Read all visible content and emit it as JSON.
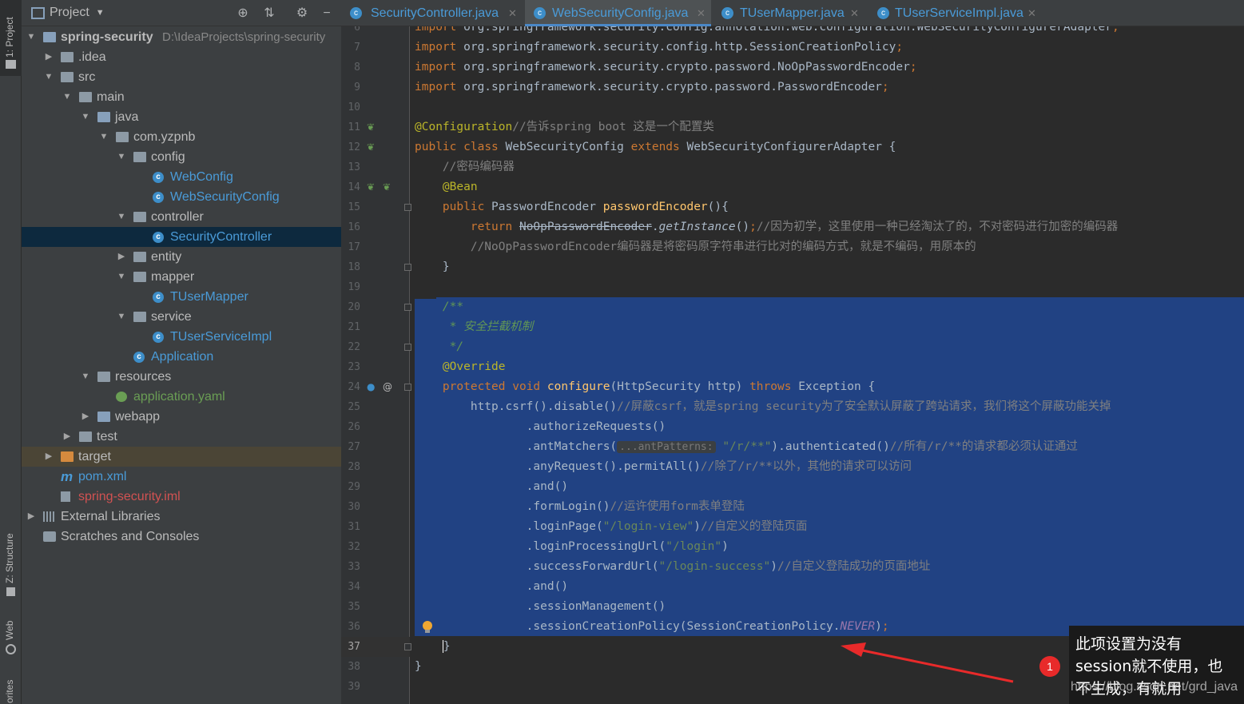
{
  "tool_strip": {
    "project_tab": "1: Project",
    "structure_tab": "Z: Structure",
    "web_tab": "Web",
    "favorites_tab": "orites"
  },
  "project_panel": {
    "title": "Project",
    "icons": [
      "globe-icon",
      "collapse-icon",
      "gear-icon",
      "minimize-icon"
    ],
    "tree": [
      {
        "label": "spring-security",
        "path": "D:\\IdeaProjects\\spring-security",
        "depth": 0,
        "expanded": true,
        "icon": "module-folder-icon"
      },
      {
        "label": ".idea",
        "depth": 1,
        "expanded": false,
        "icon": "folder-icon"
      },
      {
        "label": "src",
        "depth": 1,
        "expanded": true,
        "icon": "folder-icon"
      },
      {
        "label": "main",
        "depth": 2,
        "expanded": true,
        "icon": "folder-icon"
      },
      {
        "label": "java",
        "depth": 3,
        "expanded": true,
        "icon": "source-folder-icon"
      },
      {
        "label": "com.yzpnb",
        "depth": 4,
        "expanded": true,
        "icon": "package-icon"
      },
      {
        "label": "config",
        "depth": 5,
        "expanded": true,
        "icon": "package-icon"
      },
      {
        "label": "WebConfig",
        "depth": 6,
        "icon": "class-icon"
      },
      {
        "label": "WebSecurityConfig",
        "depth": 6,
        "icon": "class-icon"
      },
      {
        "label": "controller",
        "depth": 5,
        "expanded": true,
        "icon": "package-icon"
      },
      {
        "label": "SecurityController",
        "depth": 6,
        "icon": "class-icon",
        "selected": true
      },
      {
        "label": "entity",
        "depth": 5,
        "expanded": false,
        "icon": "package-icon"
      },
      {
        "label": "mapper",
        "depth": 5,
        "expanded": true,
        "icon": "package-icon"
      },
      {
        "label": "TUserMapper",
        "depth": 6,
        "icon": "class-icon"
      },
      {
        "label": "service",
        "depth": 5,
        "expanded": true,
        "icon": "package-icon"
      },
      {
        "label": "TUserServiceImpl",
        "depth": 6,
        "icon": "class-icon"
      },
      {
        "label": "Application",
        "depth": 5,
        "icon": "spring-boot-class-icon"
      },
      {
        "label": "resources",
        "depth": 3,
        "expanded": true,
        "icon": "resources-folder-icon"
      },
      {
        "label": "application.yaml",
        "depth": 4,
        "icon": "yaml-icon"
      },
      {
        "label": "webapp",
        "depth": 3,
        "expanded": false,
        "icon": "web-folder-icon"
      },
      {
        "label": "test",
        "depth": 2,
        "expanded": false,
        "icon": "folder-icon"
      },
      {
        "label": "target",
        "depth": 1,
        "expanded": false,
        "icon": "excluded-folder-icon",
        "highlighted": true
      },
      {
        "label": "pom.xml",
        "depth": 1,
        "icon": "maven-icon"
      },
      {
        "label": "spring-security.iml",
        "depth": 1,
        "icon": "iml-icon"
      },
      {
        "label": "External Libraries",
        "depth": 0,
        "expanded": false,
        "icon": "library-icon"
      },
      {
        "label": "Scratches and Consoles",
        "depth": 0,
        "icon": "scratches-icon"
      }
    ]
  },
  "tabs": [
    {
      "label": "SecurityController.java",
      "active": false
    },
    {
      "label": "WebSecurityConfig.java",
      "active": true
    },
    {
      "label": "TUserMapper.java",
      "active": false
    },
    {
      "label": "TUserServiceImpl.java",
      "active": false
    }
  ],
  "editor": {
    "current_line": 37,
    "lines": [
      {
        "n": 6,
        "text": "import org.springframework.security.config.annotation.web.configuration.WebSecurityConfigurerAdapter;"
      },
      {
        "n": 7,
        "text": "import org.springframework.security.config.http.SessionCreationPolicy;"
      },
      {
        "n": 8,
        "text": "import org.springframework.security.crypto.password.NoOpPasswordEncoder;"
      },
      {
        "n": 9,
        "text": "import org.springframework.security.crypto.password.PasswordEncoder;"
      },
      {
        "n": 10,
        "text": ""
      },
      {
        "n": 11,
        "annotation": "@Configuration",
        "comment": "//告诉spring boot 这是一个配置类"
      },
      {
        "n": 12,
        "text": "public class WebSecurityConfig extends WebSecurityConfigurerAdapter {"
      },
      {
        "n": 13,
        "comment": "    //密码编码器"
      },
      {
        "n": 14,
        "annotation": "    @Bean"
      },
      {
        "n": 15,
        "text": "    public PasswordEncoder passwordEncoder(){"
      },
      {
        "n": 16,
        "code": "        return NoOpPasswordEncoder.getInstance();",
        "comment": "//因为初学，这里使用一种已经淘汰了的，不对密码进行加密的编码器"
      },
      {
        "n": 17,
        "comment": "        //NoOpPasswordEncoder编码器是将密码原字符串进行比对的编码方式，就是不编码，用原本的"
      },
      {
        "n": 18,
        "text": "    }"
      },
      {
        "n": 19,
        "text": ""
      },
      {
        "n": 20,
        "doc": "    /**"
      },
      {
        "n": 21,
        "doc": "     * 安全拦截机制"
      },
      {
        "n": 22,
        "doc": "     */"
      },
      {
        "n": 23,
        "annotation": "    @Override"
      },
      {
        "n": 24,
        "text": "    protected void configure(HttpSecurity http) throws Exception {"
      },
      {
        "n": 25,
        "code": "        http.csrf().disable()",
        "comment": "//屏蔽csrf，就是spring security为了安全默认屏蔽了跨站请求，我们将这个屏蔽功能关掉"
      },
      {
        "n": 26,
        "code": "                .authorizeRequests()"
      },
      {
        "n": 27,
        "code": "                .antMatchers(",
        "hint": "...antPatterns:",
        "string": "\"/r/**\"",
        "code2": ").authenticated()",
        "comment": "//所有/r/**的请求都必须认证通过"
      },
      {
        "n": 28,
        "code": "                .anyRequest().permitAll()",
        "comment": "//除了/r/**以外，其他的请求可以访问"
      },
      {
        "n": 29,
        "code": "                .and()"
      },
      {
        "n": 30,
        "code": "                .formLogin()",
        "comment": "//运许使用form表单登陆"
      },
      {
        "n": 31,
        "code": "                .loginPage(",
        "string": "\"/login-view\"",
        "code2": ")",
        "comment": "//自定义的登陆页面"
      },
      {
        "n": 32,
        "code": "                .loginProcessingUrl(",
        "string": "\"/login\"",
        "code2": ")"
      },
      {
        "n": 33,
        "code": "                .successForwardUrl(",
        "string": "\"/login-success\"",
        "code2": ")",
        "comment": "//自定义登陆成功的页面地址"
      },
      {
        "n": 34,
        "code": "                .and()"
      },
      {
        "n": 35,
        "code": "                .sessionManagement()"
      },
      {
        "n": 36,
        "code": "                .sessionCreationPolicy(SessionCreationPolicy.",
        "const": "NEVER",
        "code2": ");"
      },
      {
        "n": 37,
        "text": "    }"
      },
      {
        "n": 38,
        "text": "}"
      },
      {
        "n": 39,
        "text": ""
      }
    ]
  },
  "annotation": {
    "badge": "1",
    "note_line1": "此项设置为没有",
    "note_line2": "session就不使用，也",
    "note_line3": "不生成，有就用",
    "watermark": "https://blog.csdn.net/grd_java"
  },
  "colors": {
    "selection": "#214283",
    "keyword": "#cc7832",
    "annotation": "#bbb529",
    "comment": "#808080",
    "string": "#6a8759",
    "method": "#ffc66d",
    "class_icon": "#3d8ec9"
  }
}
